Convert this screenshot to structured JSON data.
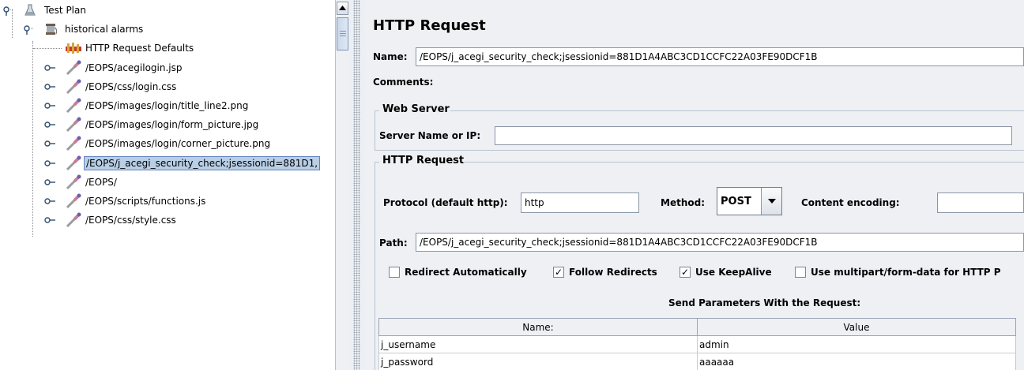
{
  "tree": {
    "nodes": [
      {
        "label": "Test Plan",
        "icon": "flask-icon"
      },
      {
        "label": "historical alarms",
        "icon": "spool-icon"
      },
      {
        "label": "HTTP Request Defaults",
        "icon": "hammer-icon"
      },
      {
        "label": "/EOPS/acegilogin.jsp",
        "icon": "pipette-icon"
      },
      {
        "label": "/EOPS/css/login.css",
        "icon": "pipette-icon"
      },
      {
        "label": "/EOPS/images/login/title_line2.png",
        "icon": "pipette-icon"
      },
      {
        "label": "/EOPS/images/login/form_picture.jpg",
        "icon": "pipette-icon"
      },
      {
        "label": "/EOPS/images/login/corner_picture.png",
        "icon": "pipette-icon"
      },
      {
        "label": "/EOPS/j_acegi_security_check;jsessionid=881D1,",
        "icon": "pipette-icon"
      },
      {
        "label": "/EOPS/",
        "icon": "pipette-icon"
      },
      {
        "label": "/EOPS/scripts/functions.js",
        "icon": "pipette-icon"
      },
      {
        "label": "/EOPS/css/style.css",
        "icon": "pipette-icon"
      }
    ],
    "selected_index": 8
  },
  "panel": {
    "title": "HTTP Request",
    "name_label": "Name:",
    "name_value": "/EOPS/j_acegi_security_check;jsessionid=881D1A4ABC3CD1CCFC22A03FE90DCF1B",
    "comments_label": "Comments:",
    "web_server_group": "Web Server",
    "server_label": "Server Name or IP:",
    "server_value": "",
    "http_request_group": "HTTP Request",
    "protocol_label": "Protocol (default http):",
    "protocol_value": "http",
    "method_label": "Method:",
    "method_value": "POST",
    "encoding_label": "Content encoding:",
    "encoding_value": "",
    "path_label": "Path:",
    "path_value": "/EOPS/j_acegi_security_check;jsessionid=881D1A4ABC3CD1CCFC22A03FE90DCF1B",
    "checkboxes": {
      "redirect": {
        "label": "Redirect Automatically",
        "checked": false
      },
      "follow": {
        "label": "Follow Redirects",
        "checked": true
      },
      "keepalive": {
        "label": "Use KeepAlive",
        "checked": true
      },
      "multipart": {
        "label": "Use multipart/form-data for HTTP P",
        "checked": false
      }
    },
    "params_title": "Send Parameters With the Request:",
    "params_columns": [
      "Name:",
      "Value"
    ],
    "params_rows": [
      {
        "name": "j_username",
        "value": "admin"
      },
      {
        "name": "j_password",
        "value": "aaaaaa"
      }
    ]
  },
  "colors": {
    "selection": "#b8cfe5",
    "panel_bg": "#eef0f4"
  }
}
